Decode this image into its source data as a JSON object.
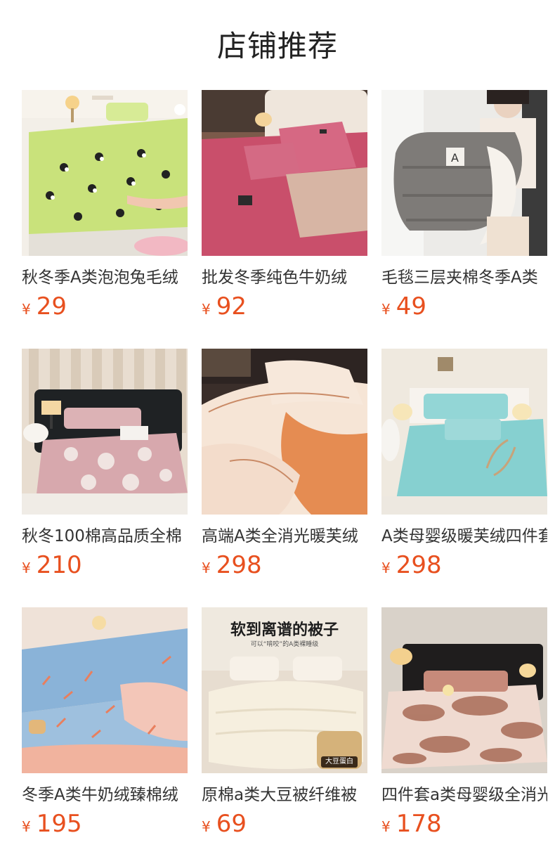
{
  "section_title": "店铺推荐",
  "currency_symbol": "¥",
  "products": [
    {
      "name": "秋冬季A类泡泡兔毛绒",
      "price": "29",
      "image": "green-panda-fitted-sheet"
    },
    {
      "name": "批发冬季纯色牛奶绒",
      "price": "92",
      "image": "rose-pink-velvet-bedding"
    },
    {
      "name": "毛毯三层夹棉冬季A类",
      "price": "49",
      "image": "grey-sherpa-blanket"
    },
    {
      "name": "秋冬100棉高品质全棉",
      "price": "210",
      "image": "pink-floral-bedding"
    },
    {
      "name": "高端A类全消光暖芙绒",
      "price": "298",
      "image": "cream-orange-velvet-bedding"
    },
    {
      "name": "A类母婴级暖芙绒四件套",
      "price": "298",
      "image": "aqua-embroidered-bedding"
    },
    {
      "name": "冬季A类牛奶绒臻棉绒",
      "price": "195",
      "image": "blue-pink-leaf-bedding"
    },
    {
      "name": "原棉a类大豆被纤维被",
      "price": "69",
      "image": "soybean-quilt",
      "overlay_headline": "软到离谱的被子",
      "overlay_sub": "可以“啃咬”的A类裸睡级",
      "overlay_badge": "大豆蛋白"
    },
    {
      "name": "四件套a类母婴级全消光",
      "price": "178",
      "image": "brown-tie-dye-bedding"
    }
  ],
  "colors": {
    "price": "#e8501f",
    "title": "#222222",
    "text": "#333333"
  }
}
